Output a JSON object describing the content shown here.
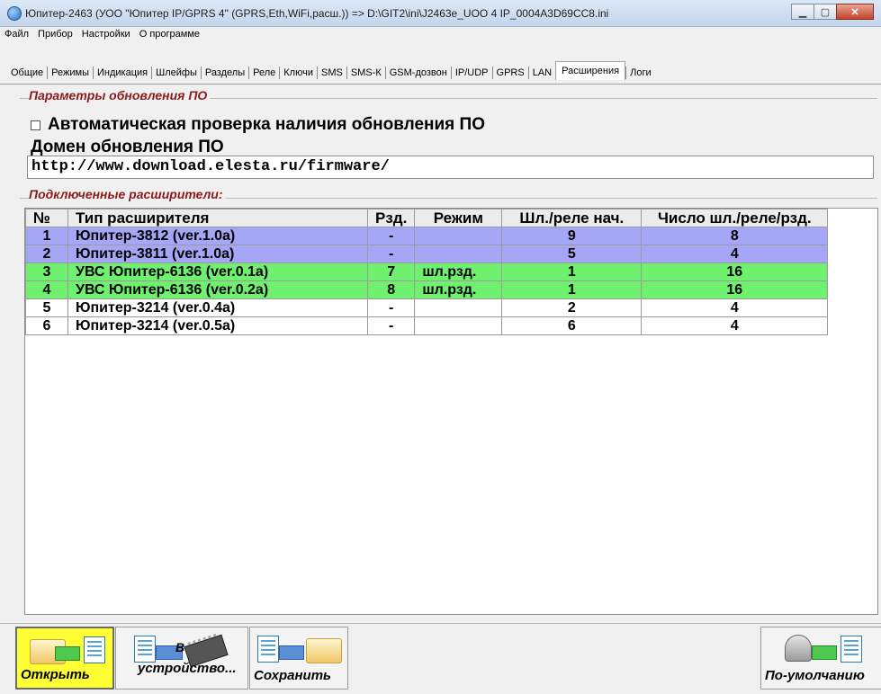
{
  "window": {
    "title": "Юпитер-2463 (УОО \"Юпитер IP/GPRS 4\" (GPRS,Eth,WiFi,расш.))  =>  D:\\GIT2\\ini\\J2463e_UOO 4 IP_0004A3D69CC8.ini"
  },
  "menu": [
    "Файл",
    "Прибор",
    "Настройки",
    "О программе"
  ],
  "tabs": [
    {
      "label": "Общие"
    },
    {
      "label": "Режимы"
    },
    {
      "label": "Индикация"
    },
    {
      "label": "Шлейфы"
    },
    {
      "label": "Разделы"
    },
    {
      "label": "Реле"
    },
    {
      "label": "Ключи"
    },
    {
      "label": "SMS"
    },
    {
      "label": "SMS-К"
    },
    {
      "label": "GSM-дозвон"
    },
    {
      "label": "IP/UDP"
    },
    {
      "label": "GPRS"
    },
    {
      "label": "LAN"
    },
    {
      "label": "Расширения",
      "active": true
    },
    {
      "label": "Логи"
    }
  ],
  "update": {
    "section_title": "Параметры обновления ПО",
    "auto_check_label": "Автоматическая проверка наличия обновления ПО",
    "auto_check_value": false,
    "domain_label": "Домен обновления ПО",
    "domain_value": "http://www.download.elesta.ru/firmware/"
  },
  "extenders": {
    "section_title": "Подключенные расширители:",
    "columns": [
      "№",
      "Тип расширителя",
      "Рзд.",
      "Режим",
      "Шл./реле нач.",
      "Число шл./реле/рзд."
    ],
    "rows": [
      {
        "n": "1",
        "type": "Юпитер-3812 (ver.1.0a)",
        "rzd": "-",
        "mode": "",
        "start": "9",
        "count": "8",
        "color": "#a6a6f7"
      },
      {
        "n": "2",
        "type": "Юпитер-3811 (ver.1.0a)",
        "rzd": "-",
        "mode": "",
        "start": "5",
        "count": "4",
        "color": "#a6a6f7"
      },
      {
        "n": "3",
        "type": "УВС Юпитер-6136 (ver.0.1a)",
        "rzd": "7",
        "mode": "шл.рзд.",
        "start": "1",
        "count": "16",
        "color": "#6ff06f"
      },
      {
        "n": "4",
        "type": "УВС Юпитер-6136 (ver.0.2a)",
        "rzd": "8",
        "mode": "шл.рзд.",
        "start": "1",
        "count": "16",
        "color": "#6ff06f"
      },
      {
        "n": "5",
        "type": "Юпитер-3214 (ver.0.4a)",
        "rzd": "-",
        "mode": "",
        "start": "2",
        "count": "4",
        "color": "#ffffff"
      },
      {
        "n": "6",
        "type": "Юпитер-3214 (ver.0.5a)",
        "rzd": "-",
        "mode": "",
        "start": "6",
        "count": "4",
        "color": "#ffffff"
      }
    ]
  },
  "toolbar": {
    "open_label": "Открыть",
    "to_device_label": "устройство...",
    "to_device_prefix": "В",
    "save_label": "Сохранить",
    "defaults_label": "По-умолчанию"
  },
  "colors": {
    "section_title": "#8b1b1b",
    "open_button_bg": "#ffff33"
  },
  "icons": [
    "app-icon",
    "minimize-icon",
    "maximize-icon",
    "close-icon",
    "document-icon",
    "folder-icon",
    "arrow-right-icon",
    "chip-icon",
    "robot-icon"
  ]
}
